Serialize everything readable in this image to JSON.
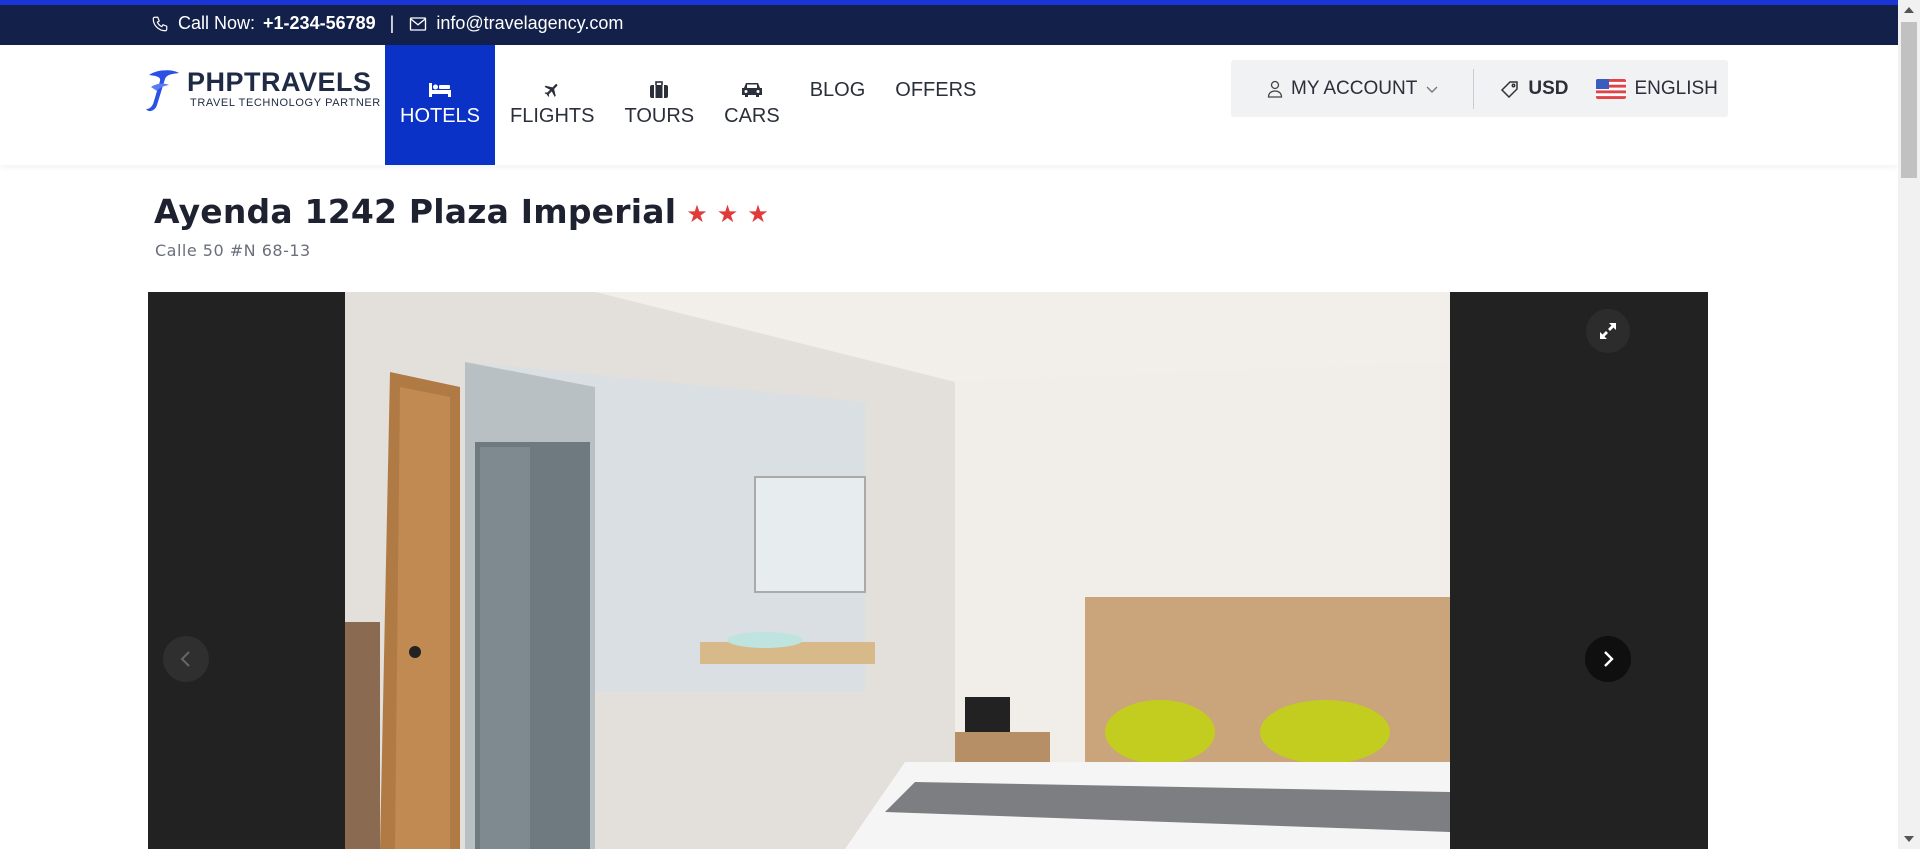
{
  "topbar": {
    "call_label": "Call Now:",
    "phone": "+1-234-56789",
    "separator": "|",
    "email": "info@travelagency.com"
  },
  "logo": {
    "title": "PHPTRAVELS",
    "subtitle": "TRAVEL TECHNOLOGY PARTNER"
  },
  "nav": {
    "items": [
      {
        "label": "HOTELS",
        "icon": "bed-icon",
        "active": true
      },
      {
        "label": "FLIGHTS",
        "icon": "plane-icon",
        "active": false
      },
      {
        "label": "TOURS",
        "icon": "suitcase-icon",
        "active": false
      },
      {
        "label": "CARS",
        "icon": "car-icon",
        "active": false
      },
      {
        "label": "BLOG",
        "icon": "",
        "active": false
      },
      {
        "label": "OFFERS",
        "icon": "",
        "active": false
      }
    ]
  },
  "account": {
    "label": "MY ACCOUNT",
    "currency": "USD",
    "language": "ENGLISH"
  },
  "hotel": {
    "name": "Ayenda 1242 Plaza Imperial",
    "stars": 3,
    "address": "Calle 50 #N 68-13"
  },
  "colors": {
    "topbar_bg": "#13204a",
    "accent": "#0b32c6",
    "star": "#e03a3a"
  }
}
